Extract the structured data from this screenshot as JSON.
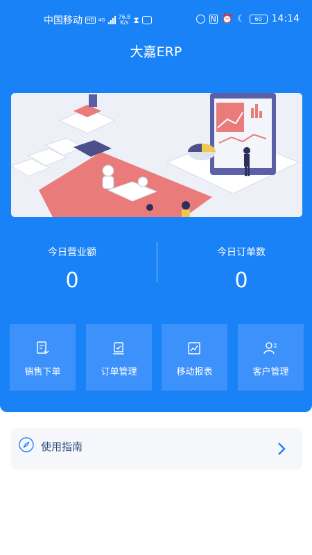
{
  "status_bar": {
    "carrier": "中国移动",
    "hd_badge": "HD",
    "network": "4G",
    "speed_value": "76.8",
    "speed_unit": "K/s",
    "nfc": "N",
    "battery": "60",
    "time": "14:14"
  },
  "app": {
    "title": "大嘉ERP"
  },
  "banner": {
    "image_name": "office-illustration"
  },
  "stats": [
    {
      "label": "今日营业额",
      "value": "0"
    },
    {
      "label": "今日订单数",
      "value": "0"
    }
  ],
  "menu": [
    {
      "label": "销售下单",
      "icon": "sales-order-icon"
    },
    {
      "label": "订单管理",
      "icon": "order-management-icon"
    },
    {
      "label": "移动报表",
      "icon": "mobile-report-icon"
    },
    {
      "label": "客户管理",
      "icon": "customer-management-icon"
    }
  ],
  "guide": {
    "label": "使用指南",
    "icon": "compass-icon",
    "arrow": "chevron-right-icon"
  },
  "colors": {
    "primary": "#1a82f7",
    "tile": "#3d91fb",
    "banner_bg": "#eef0f7",
    "guide_bg": "#f5f7fb",
    "guide_text": "#2c4a7a",
    "accent": "#e97b7b"
  }
}
